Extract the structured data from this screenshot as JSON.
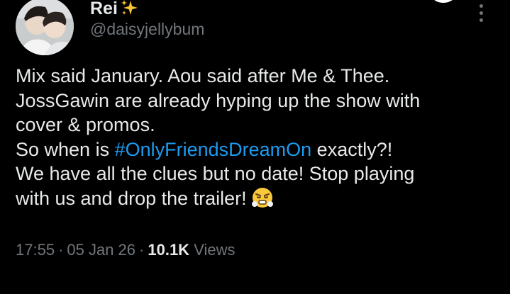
{
  "tweet": {
    "author": {
      "display_name": "Rei",
      "badge_icon": "sparkles-emoji",
      "handle": "@daisyjellybum"
    },
    "body": {
      "line1": "Mix said January. Aou said after Me & Thee.",
      "line2": "JossGawin are already hyping up the show with",
      "line3": "cover & promos.",
      "line4_before": "So when is ",
      "hashtag": "#OnlyFriendsDreamOn",
      "line4_after": " exactly?!",
      "line5": "We have all the clues but no date! Stop playing",
      "line6": "with us and drop the trailer!",
      "emoji_icon": "face-with-steam-from-nose-emoji"
    },
    "meta": {
      "time": "17:55",
      "separator": "·",
      "date": "05 Jan 26",
      "views_count": "10.1K",
      "views_label": "Views"
    }
  },
  "colors": {
    "background": "#000000",
    "text_primary": "#e7e9ea",
    "text_secondary": "#71767b",
    "link": "#1d9bf0"
  }
}
